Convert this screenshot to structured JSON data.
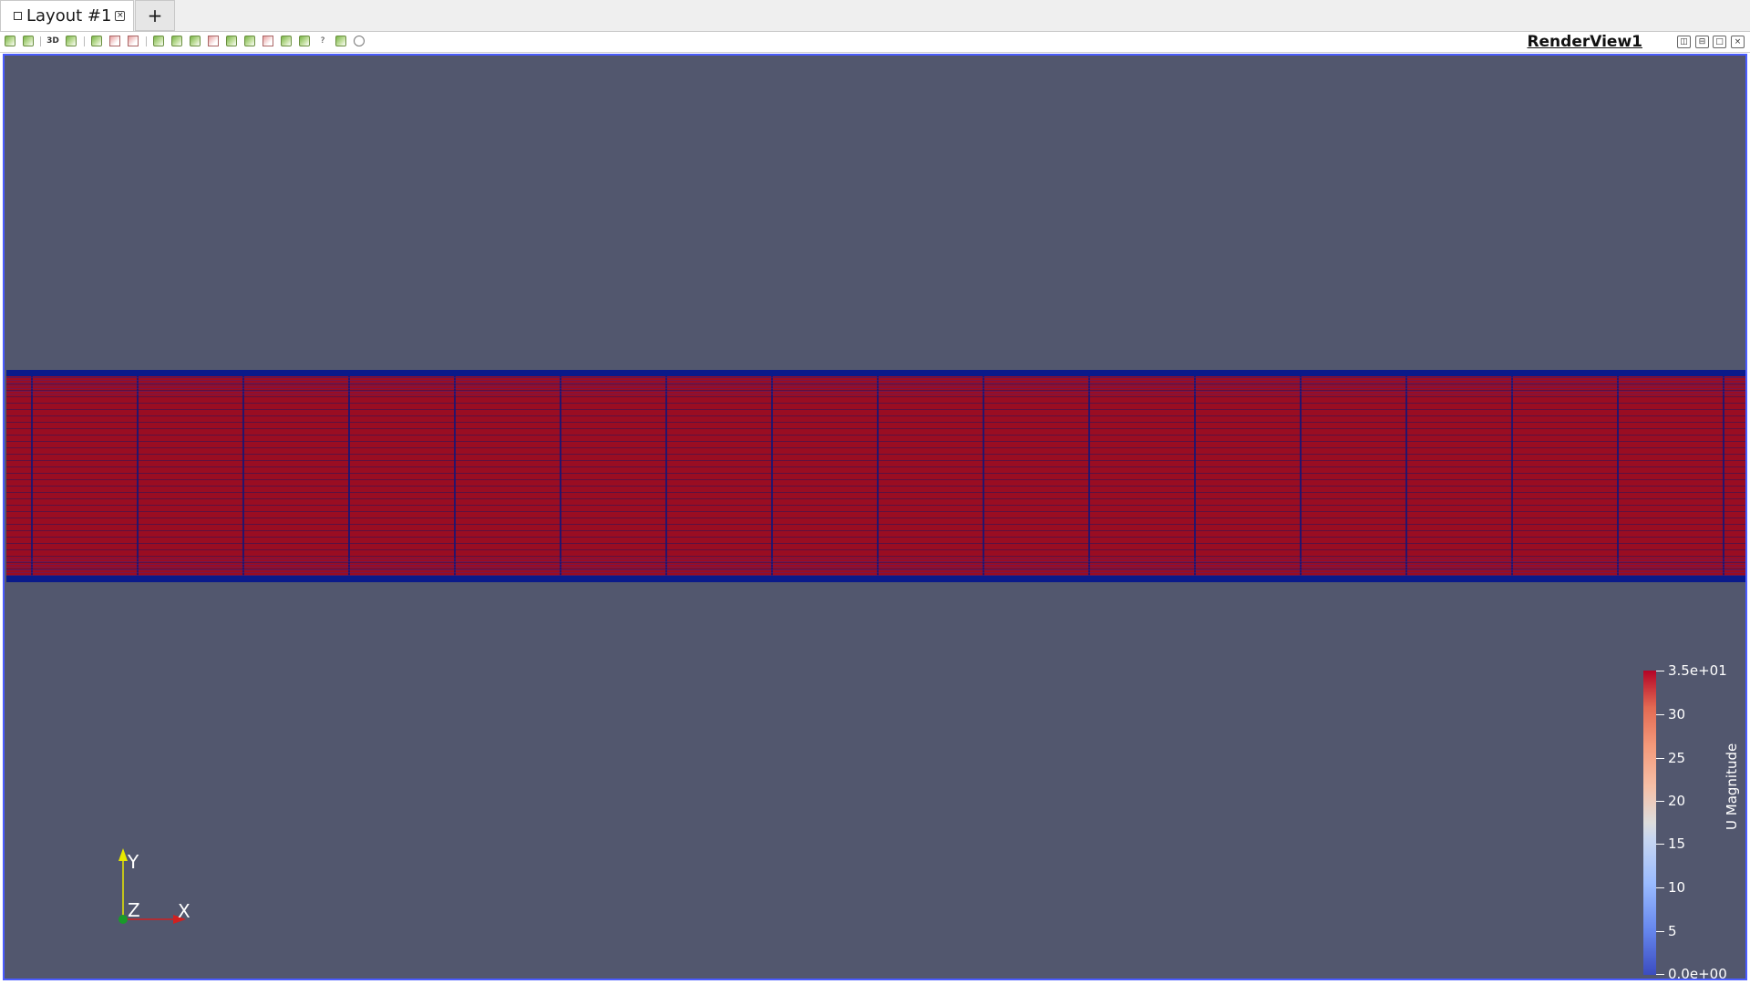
{
  "tabs": [
    {
      "label": "Layout #1",
      "active": true
    }
  ],
  "add_tab_label": "+",
  "toolbar": {
    "mode_3d_label": "3D",
    "icons": [
      "reset-camera-icon",
      "zoom-to-data-icon",
      "3d-toggle-icon",
      "camera-undo-icon",
      "camera-redo-icon",
      "select-cells-icon",
      "select-points-icon",
      "interactive-select-icon",
      "hover-points-icon",
      "grow-selection-icon",
      "shrink-selection-icon",
      "clear-selection-icon",
      "query-icon",
      "find-data-icon"
    ]
  },
  "view": {
    "title": "RenderView1",
    "background_color": "#52576e",
    "border_color": "#4a5cff"
  },
  "orientation_axes": {
    "x_label": "X",
    "y_label": "Y",
    "z_label": "Z",
    "x_color": "#d02020",
    "y_color": "#e8e800",
    "z_color": "#1a9a2a"
  },
  "legend": {
    "title": "U Magnitude",
    "ticks": [
      "3.5e+01",
      "30",
      "25",
      "20",
      "15",
      "10",
      "5",
      "0.0e+00"
    ],
    "colormap": "Cool to Warm"
  }
}
